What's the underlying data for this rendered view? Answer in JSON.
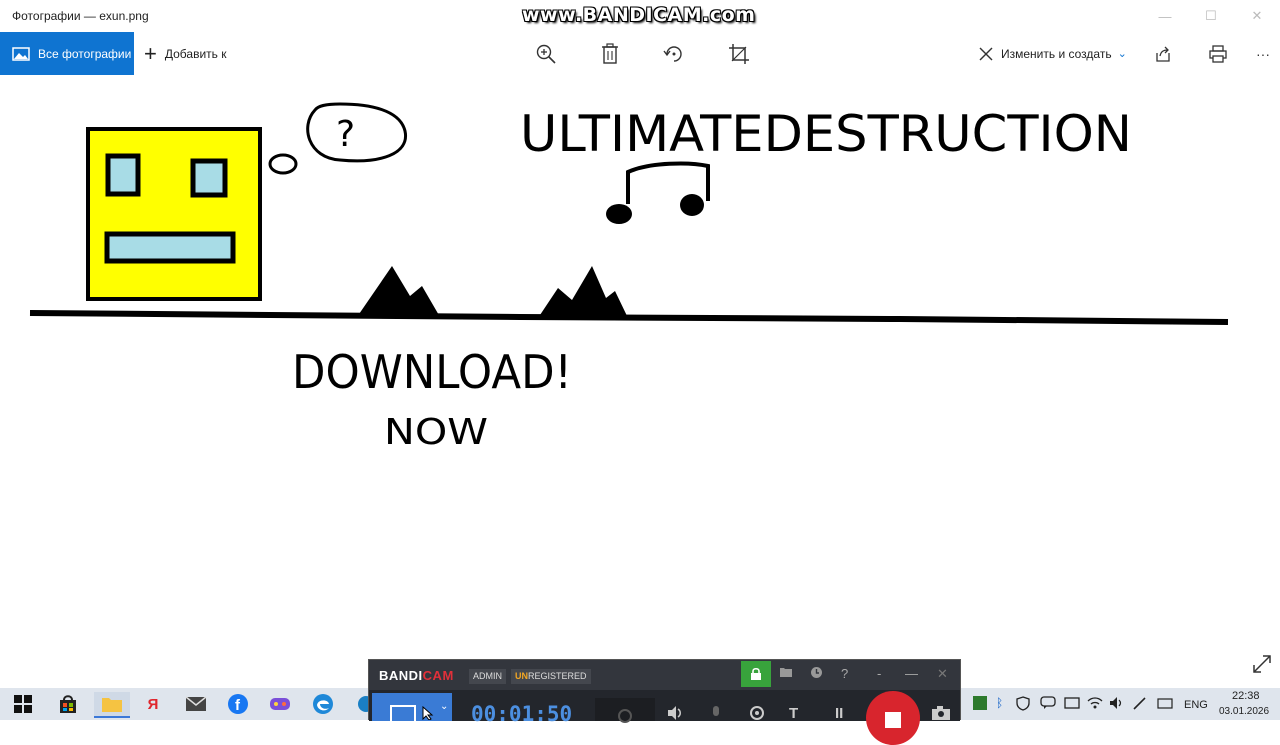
{
  "window": {
    "title": "Фотографии — exun.png",
    "watermark": "www.BANDICAM.com",
    "controls": {
      "minimize": "—",
      "maximize": "☐",
      "close": "✕"
    }
  },
  "toolbar": {
    "all_photos_label": "Все фотографии",
    "add_label": "Добавить к",
    "edit_create_label": "Изменить и создать",
    "more_label": "···"
  },
  "drawing": {
    "question_mark": "?",
    "title_text": "ULTIMATEDESTRUCTION",
    "download_text": "DOWNLOAD!",
    "now_text": "NOW"
  },
  "bandicam": {
    "logo_main": "BANDI",
    "logo_accent": "CAM",
    "admin_badge": "ADMIN",
    "unregistered_prefix": "UN",
    "unregistered_rest": "REGISTERED",
    "timer": "00:01:50",
    "header_icons": [
      "folder-icon",
      "clock-icon",
      "help-icon",
      "collapse-icon",
      "minimize-icon",
      "close-icon"
    ],
    "help_label": "?",
    "text_tool_label": "T",
    "pause_label": "II"
  },
  "taskbar": {
    "yandex_label": "Я",
    "facebook_label": "f",
    "language": "ENG",
    "time": "22:38",
    "date": "03.01.2026"
  },
  "colors": {
    "accent": "#0f74d1",
    "cube_yellow": "#ffff00",
    "cube_light_blue": "#a8dce6",
    "bandicam_red": "#d8252d",
    "bandicam_green": "#38a33c",
    "bandicam_timer": "#4c8fe0"
  }
}
